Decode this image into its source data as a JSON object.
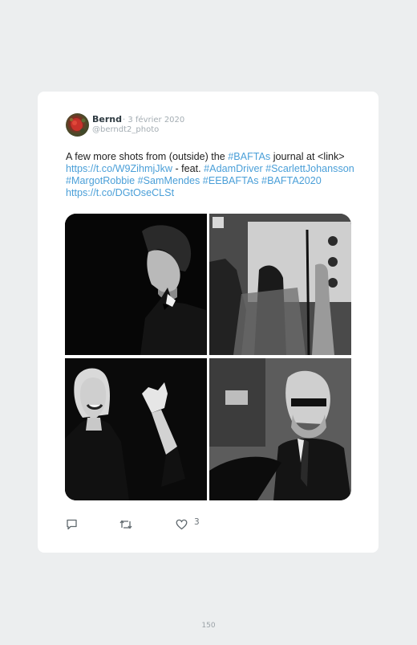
{
  "tweet": {
    "author_name": "Bernd",
    "date": "· 3 février 2020",
    "handle": "@berndt2_photo",
    "text_segments": [
      {
        "text": "A few more shots from (outside) the ",
        "link": false
      },
      {
        "text": "#BAFTAs",
        "link": true
      },
      {
        "text": " journal at <link> ",
        "link": false
      },
      {
        "text": "https://t.co/W9ZihmjJkw",
        "link": true
      },
      {
        "text": " - feat. ",
        "link": false
      },
      {
        "text": "#AdamDriver #ScarlettJohansson #MargotRobbie #SamMendes #EEBAFTAs #BAFTA2020 https://t.co/DGtOseCLSt",
        "link": true
      }
    ],
    "photos": [
      {
        "subject": "man in tuxedo, profile view, black background"
      },
      {
        "subject": "red carpet scene with camera crew and woman in gown"
      },
      {
        "subject": "smiling woman waving in black lace dress"
      },
      {
        "subject": "man with glasses and beard at car door"
      }
    ],
    "actions": {
      "reply_icon": "reply-icon",
      "retweet_icon": "retweet-icon",
      "like_icon": "heart-icon",
      "like_count": "3"
    }
  },
  "page": {
    "number": "150"
  },
  "colors": {
    "link": "#4a9fd8",
    "muted": "#a4adb3",
    "background": "#eceeef"
  }
}
